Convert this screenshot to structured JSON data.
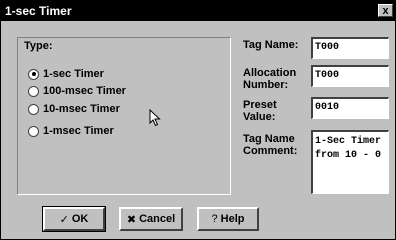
{
  "window": {
    "title": "1-sec Timer",
    "close_glyph": "x"
  },
  "type_group": {
    "label": "Type:",
    "options": [
      {
        "label": "1-sec Timer",
        "selected": true
      },
      {
        "label": "100-msec Timer",
        "selected": false
      },
      {
        "label": "10-msec Timer",
        "selected": false
      },
      {
        "label": "1-msec Timer",
        "selected": false
      }
    ]
  },
  "fields": {
    "tag_name": {
      "label": "Tag Name:",
      "value": "T000"
    },
    "allocation_number": {
      "label": "Allocation\nNumber:",
      "value": "T000"
    },
    "preset_value": {
      "label": "Preset\nValue:",
      "value": "0010"
    },
    "tag_name_comment": {
      "label": "Tag Name\nComment:",
      "value": "1-Sec Timer\nfrom 10 - 0"
    }
  },
  "buttons": {
    "ok": {
      "label": "OK",
      "icon": "check-icon"
    },
    "cancel": {
      "label": "Cancel",
      "icon": "cancel-x-icon"
    },
    "help": {
      "label": "Help",
      "icon": "question-icon"
    }
  }
}
